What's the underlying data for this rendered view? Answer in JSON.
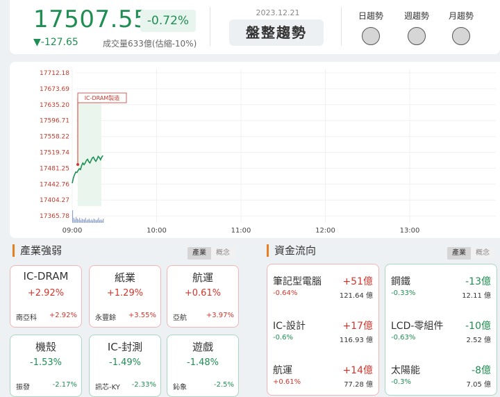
{
  "header": {
    "price": "17507.55",
    "pct_change": "-0.72%",
    "change": "▼-127.65",
    "volume": "成交量633億(估縮-10%)",
    "date": "2023.12.21",
    "trend_label": "盤整趨勢",
    "trend_items": [
      {
        "label": "日趨勢"
      },
      {
        "label": "週趨勢"
      },
      {
        "label": "月趨勢"
      }
    ]
  },
  "chart_data": {
    "type": "line",
    "yticks": [
      "17712.18",
      "17673.69",
      "17635.20",
      "17596.71",
      "17558.22",
      "17519.74",
      "17481.25",
      "17442.76",
      "17404.27",
      "17365.78"
    ],
    "xticks": [
      "09:00",
      "10:00",
      "11:00",
      "12:00",
      "13:00"
    ],
    "ylim": [
      17365.78,
      17712.18
    ],
    "annotation": "IC-DRAM製造",
    "color_line": "#1e8e52",
    "color_axis": "#c0392b",
    "price_series": [
      17445,
      17458,
      17466,
      17472,
      17471,
      17476,
      17480,
      17478,
      17488,
      17494,
      17490,
      17494,
      17500,
      17503,
      17497,
      17494,
      17500,
      17506,
      17508,
      17502,
      17498,
      17503,
      17510,
      17507,
      17502,
      17508,
      17512
    ],
    "volume_series": [
      15,
      6,
      4,
      7,
      5,
      4,
      6,
      3,
      5,
      4,
      4,
      6,
      3,
      4,
      5,
      3,
      4,
      3,
      5,
      4,
      3,
      4,
      6,
      3,
      4,
      3,
      5
    ],
    "volume_max": 15
  },
  "industry": {
    "title": "產業強弱",
    "toggle": [
      "產業",
      "概念"
    ],
    "cards": [
      {
        "name": "IC-DRAM",
        "pct": "+2.92%",
        "stock": "南亞科",
        "stock_pct": "+2.92%",
        "dir": "up"
      },
      {
        "name": "紙業",
        "pct": "+1.29%",
        "stock": "永豐餘",
        "stock_pct": "+3.55%",
        "dir": "up"
      },
      {
        "name": "航運",
        "pct": "+0.61%",
        "stock": "亞航",
        "stock_pct": "+3.97%",
        "dir": "up"
      },
      {
        "name": "機殼",
        "pct": "-1.53%",
        "stock": "振發",
        "stock_pct": "-2.17%",
        "dir": "down"
      },
      {
        "name": "IC-封測",
        "pct": "-1.49%",
        "stock": "訊芯-KY",
        "stock_pct": "-2.33%",
        "dir": "down"
      },
      {
        "name": "遊戲",
        "pct": "-1.48%",
        "stock": "鈊象",
        "stock_pct": "-2.5%",
        "dir": "down"
      }
    ]
  },
  "fund_flow": {
    "title": "資金流向",
    "toggle": [
      "產業",
      "概念"
    ],
    "inflow": [
      {
        "name": "筆記型電腦",
        "amount": "+51億",
        "pct": "-0.64%",
        "volume": "121.64 億"
      },
      {
        "name": "IC-設計",
        "amount": "+17億",
        "pct": "-0.6%",
        "volume": "116.93 億"
      },
      {
        "name": "航運",
        "amount": "+14億",
        "pct": "+0.61%",
        "volume": "77.28 億"
      }
    ],
    "outflow": [
      {
        "name": "鋼鐵",
        "amount": "-13億",
        "pct": "-0.33%",
        "volume": "12.11 億"
      },
      {
        "name": "LCD-零組件",
        "amount": "-10億",
        "pct": "-0.63%",
        "volume": "2.52 億"
      },
      {
        "name": "太陽能",
        "amount": "-8億",
        "pct": "-0.3%",
        "volume": "7.05 億"
      }
    ]
  }
}
